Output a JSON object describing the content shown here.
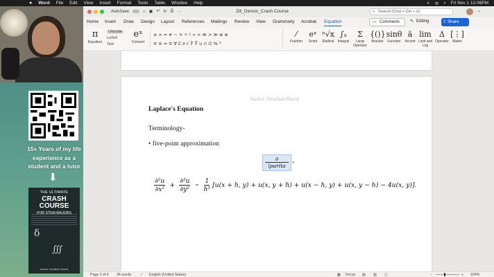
{
  "menubar": {
    "apple": "",
    "app_name": "Word",
    "items": [
      "File",
      "Edit",
      "View",
      "Insert",
      "Format",
      "Tools",
      "Table",
      "Window",
      "Help"
    ],
    "datetime": "Fri Nov 1  12:06PM"
  },
  "sidebar": {
    "promo_text": "15+ Years of my life experience as a student and a tutor",
    "book": {
      "line1": "THE ULTIMATE",
      "line2": "CRASH COURSE",
      "line3": "FOR STEM MAJORS",
      "author": "author Jonathan David"
    }
  },
  "titlebar": {
    "autosave": "AutoSave",
    "doc_title": "Zill_Dennis_Crash Course",
    "search_placeholder": "Search (Cmd + Ctrl + U)"
  },
  "tabs": {
    "items": [
      "Home",
      "Insert",
      "Draw",
      "Design",
      "Layout",
      "References",
      "Mailings",
      "Review",
      "View",
      "Grammarly",
      "Acrobat",
      "Equation"
    ],
    "active": "Equation",
    "comments": "Comments",
    "editing": "Editing",
    "share": "Share"
  },
  "ribbon": {
    "equation_label": "Equation",
    "unicode": "Unicode",
    "latex": "LaTeX",
    "text": "Text",
    "convert": "Convert",
    "symbols_row1": "± ∞ = ≠ ~ × ÷ ! ∝ < ≪ > ≫ ≤ ≥",
    "symbols_row2": "∓ ≅ ≈ ≡ ∀ ∁ ∂ √ ∛ ∜ ∪ ∩ ∅ % °",
    "tools": [
      "Fraction",
      "Script",
      "Radical",
      "Integral",
      "Large Operator",
      "Bracket",
      "Function",
      "Accent",
      "Limit and Log",
      "Operator",
      "Matrix"
    ]
  },
  "document": {
    "header": "Author Jonathan David",
    "heading": "Laplace's Equation",
    "terminology": "Terminology-",
    "bullet": "• five-point approximation",
    "eq_box_num": "∂",
    "eq_box_den": "\\parita",
    "formula": {
      "t1_num": "∂²u",
      "t1_den": "∂x²",
      "plus": "+",
      "t2_num": "∂²u",
      "t2_den": "∂y²",
      "approx": "≈",
      "t3_num": "1",
      "t3_den": "h²",
      "body": "[u(x + h, y) + u(x, y + h) + u(x − h, y) + u(x, y − h) − 4u(x, y)]."
    }
  },
  "statusbar": {
    "page": "Page 2 of 4",
    "words": "36 words",
    "language": "English (United States)",
    "focus": "Focus",
    "zoom": "164%"
  }
}
